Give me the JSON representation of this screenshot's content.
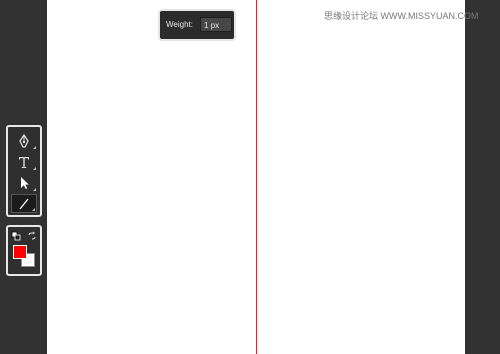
{
  "stroke_panel": {
    "weight_label": "Weight:",
    "weight_value": "1 px"
  },
  "watermark": {
    "text": "思缘设计论坛 WWW.MISSYUAN.COM"
  },
  "tools": [
    {
      "name": "pen-tool",
      "icon": "pen-icon"
    },
    {
      "name": "type-tool",
      "icon": "type-icon",
      "glyph": "T"
    },
    {
      "name": "direct-selection-tool",
      "icon": "arrow-cursor-icon"
    },
    {
      "name": "line-tool",
      "icon": "line-segment-icon",
      "selected": true
    }
  ],
  "colors": {
    "fill": "#ff0000",
    "stroke": "#ffffff",
    "guide": "#d9272e",
    "ui_dark": "#323232"
  }
}
